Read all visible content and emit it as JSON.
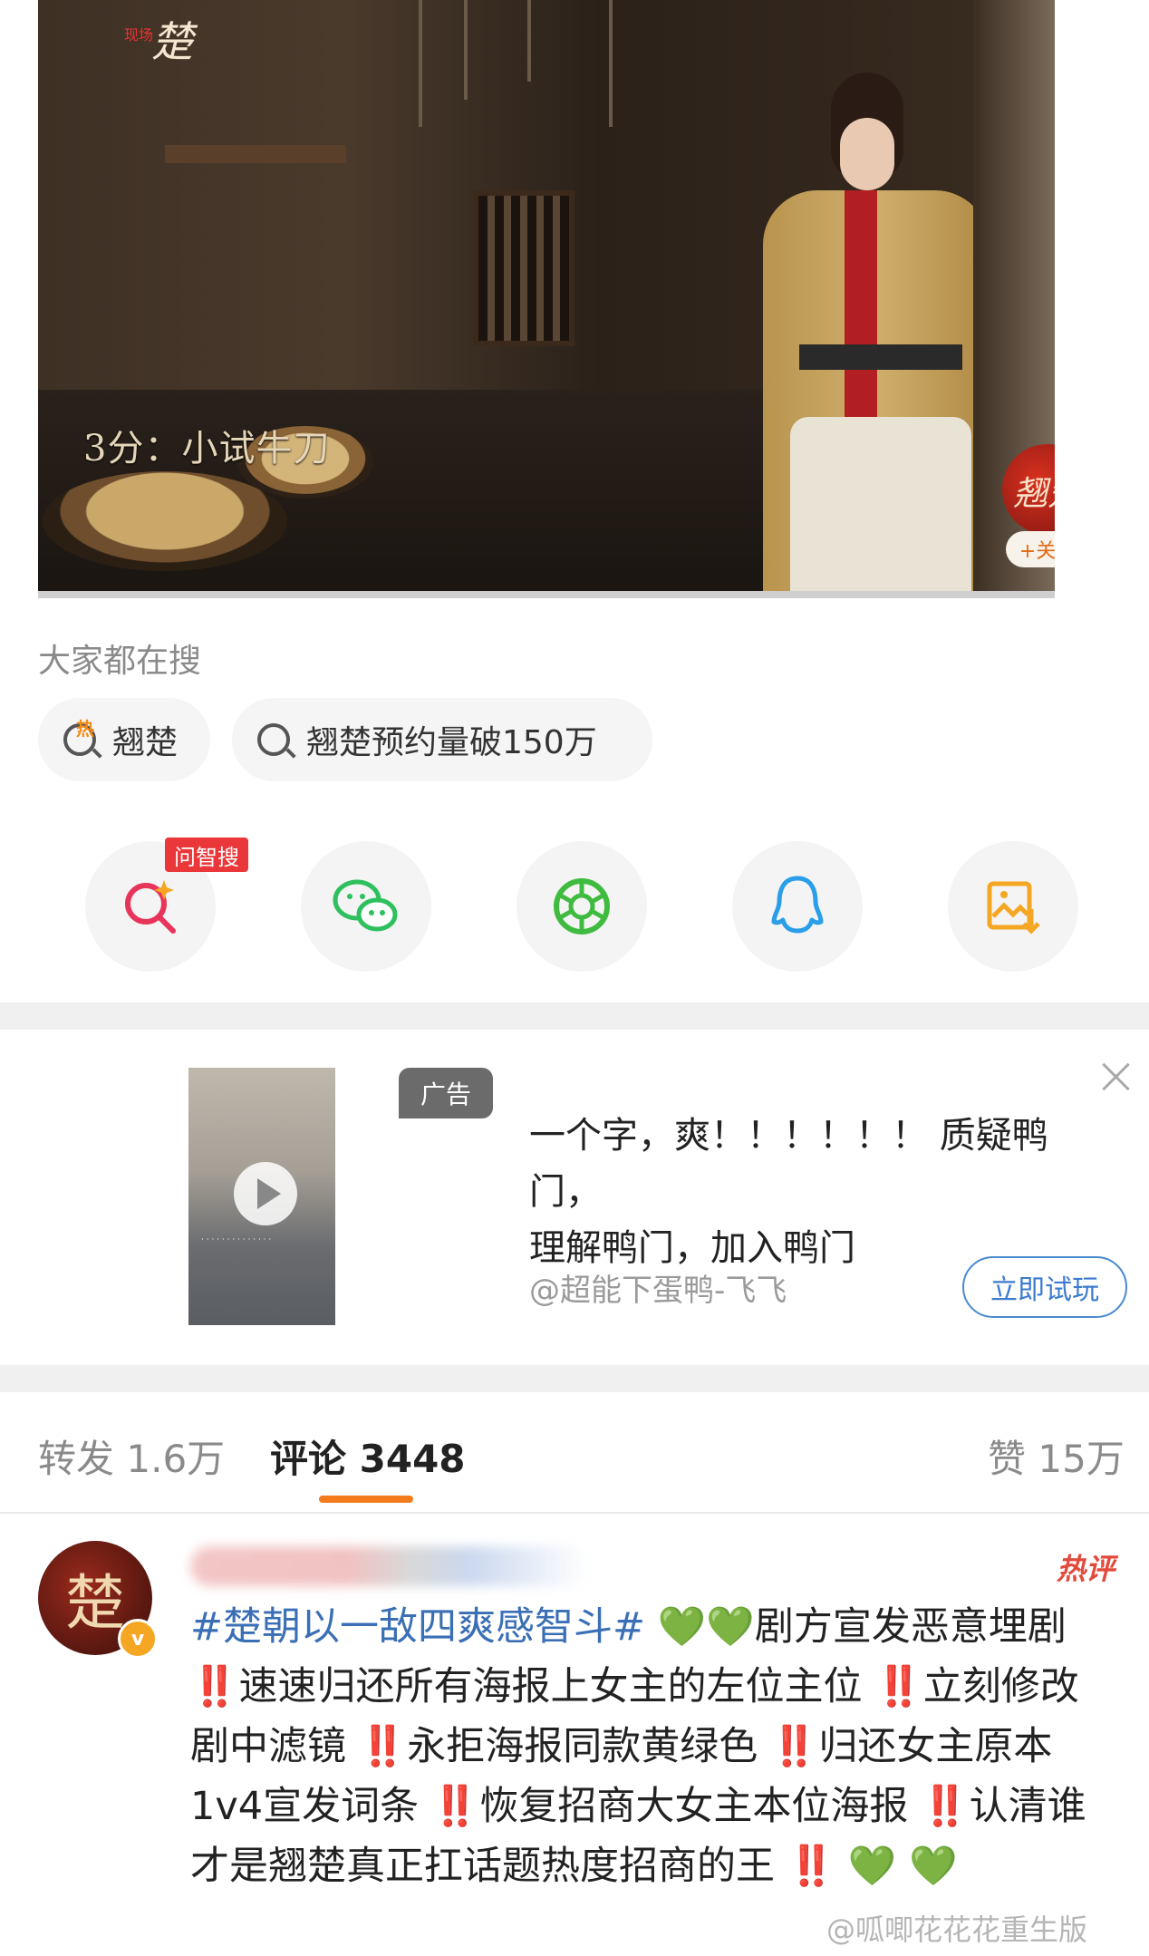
{
  "video": {
    "logo_small": "现场",
    "logo_main": "楚",
    "subtitle": "3分：小试牛刀",
    "channel_avatar_text": "翘楚",
    "follow_label": "+关注"
  },
  "search": {
    "title": "大家都在搜",
    "chips": [
      {
        "label": "翘楚",
        "icon": "hot-search-icon"
      },
      {
        "label": "翘楚预约量破150万",
        "icon": "search-icon"
      }
    ]
  },
  "share": {
    "badge": "问智搜",
    "items": [
      "ai-search-icon",
      "wechat-icon",
      "moments-icon",
      "qq-icon",
      "save-image-icon"
    ],
    "colors": {
      "ai": "#e8345a",
      "wechat": "#2ec05e",
      "moments": "#3fbb3f",
      "qq": "#2a9ee8",
      "save": "#f5a623"
    }
  },
  "ad": {
    "badge": "广告",
    "text_line1": "一个字，爽！！！！！！ 质疑鸭门，",
    "text_line2": "理解鸭门，加入鸭门",
    "author": "@超能下蛋鸭-飞飞",
    "button": "立即试玩"
  },
  "tabs": {
    "repost_label": "转发",
    "repost_count": "1.6万",
    "comment_label": "评论",
    "comment_count": "3448",
    "like_label": "赞",
    "like_count": "15万",
    "accent": "#f47b1c"
  },
  "comment": {
    "avatar_text": "楚",
    "verify": "v",
    "hot_tag": "热评",
    "topic": "#楚朝以一敌四爽感智斗#",
    "seg1": "剧方宣发恶意埋剧",
    "seg2": "速速归还所有海报上女主的左位主位",
    "seg3": "立刻修改剧中滤镜",
    "seg4": "永拒海报同款黄绿色",
    "seg5": "归还女主原本1v4宣发词条",
    "seg6": "恢复招商大女主本位海报",
    "seg7": "认清谁才是翘楚真正扛话题热度招商的王",
    "bang": "‼️",
    "heart": "💚"
  },
  "watermark": "@呱唧花花花重生版"
}
